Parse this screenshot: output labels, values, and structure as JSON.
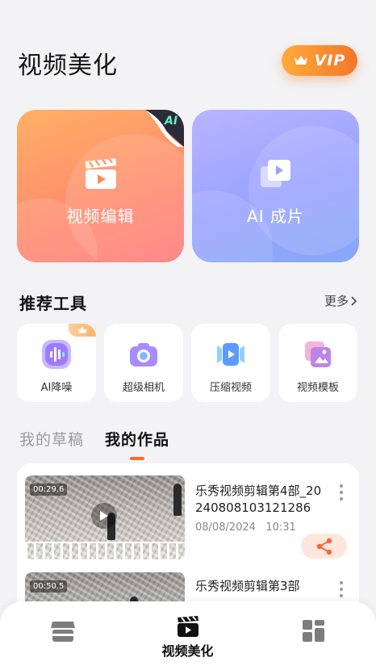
{
  "header": {
    "title": "视频美化",
    "vip_label": "VIP"
  },
  "hero_cards": {
    "edit": {
      "label": "视频编辑",
      "badge": "AI"
    },
    "ai": {
      "label": "AI 成片"
    }
  },
  "tools_section": {
    "title": "推荐工具",
    "more_label": "更多",
    "items": [
      {
        "label": "AI降噪",
        "icon": "audio-wave-icon",
        "pro": true
      },
      {
        "label": "超级相机",
        "icon": "camera-icon"
      },
      {
        "label": "压缩视频",
        "icon": "compress-video-icon"
      },
      {
        "label": "视频模板",
        "icon": "template-icon"
      }
    ]
  },
  "tabs": {
    "drafts": "我的草稿",
    "works": "我的作品",
    "active": "works"
  },
  "works": [
    {
      "duration": "00:29.6",
      "title": "乐秀视频剪辑第4部_20240808103121286",
      "date": "08/08/2024",
      "time": "10:31"
    },
    {
      "duration": "00:50.5",
      "title": "乐秀视频剪辑第3部"
    }
  ],
  "bottom_nav": {
    "items": [
      {
        "icon": "store-icon",
        "label": ""
      },
      {
        "icon": "clapper-play-icon",
        "label": "视频美化",
        "active": true
      },
      {
        "icon": "grid-icon",
        "label": ""
      }
    ]
  },
  "colors": {
    "accent": "#ff6a2a",
    "vip_start": "#ffab3a",
    "vip_end": "#f4762a",
    "hero_edit": "#ff9a6c",
    "hero_ai": "#9aa2ff"
  }
}
